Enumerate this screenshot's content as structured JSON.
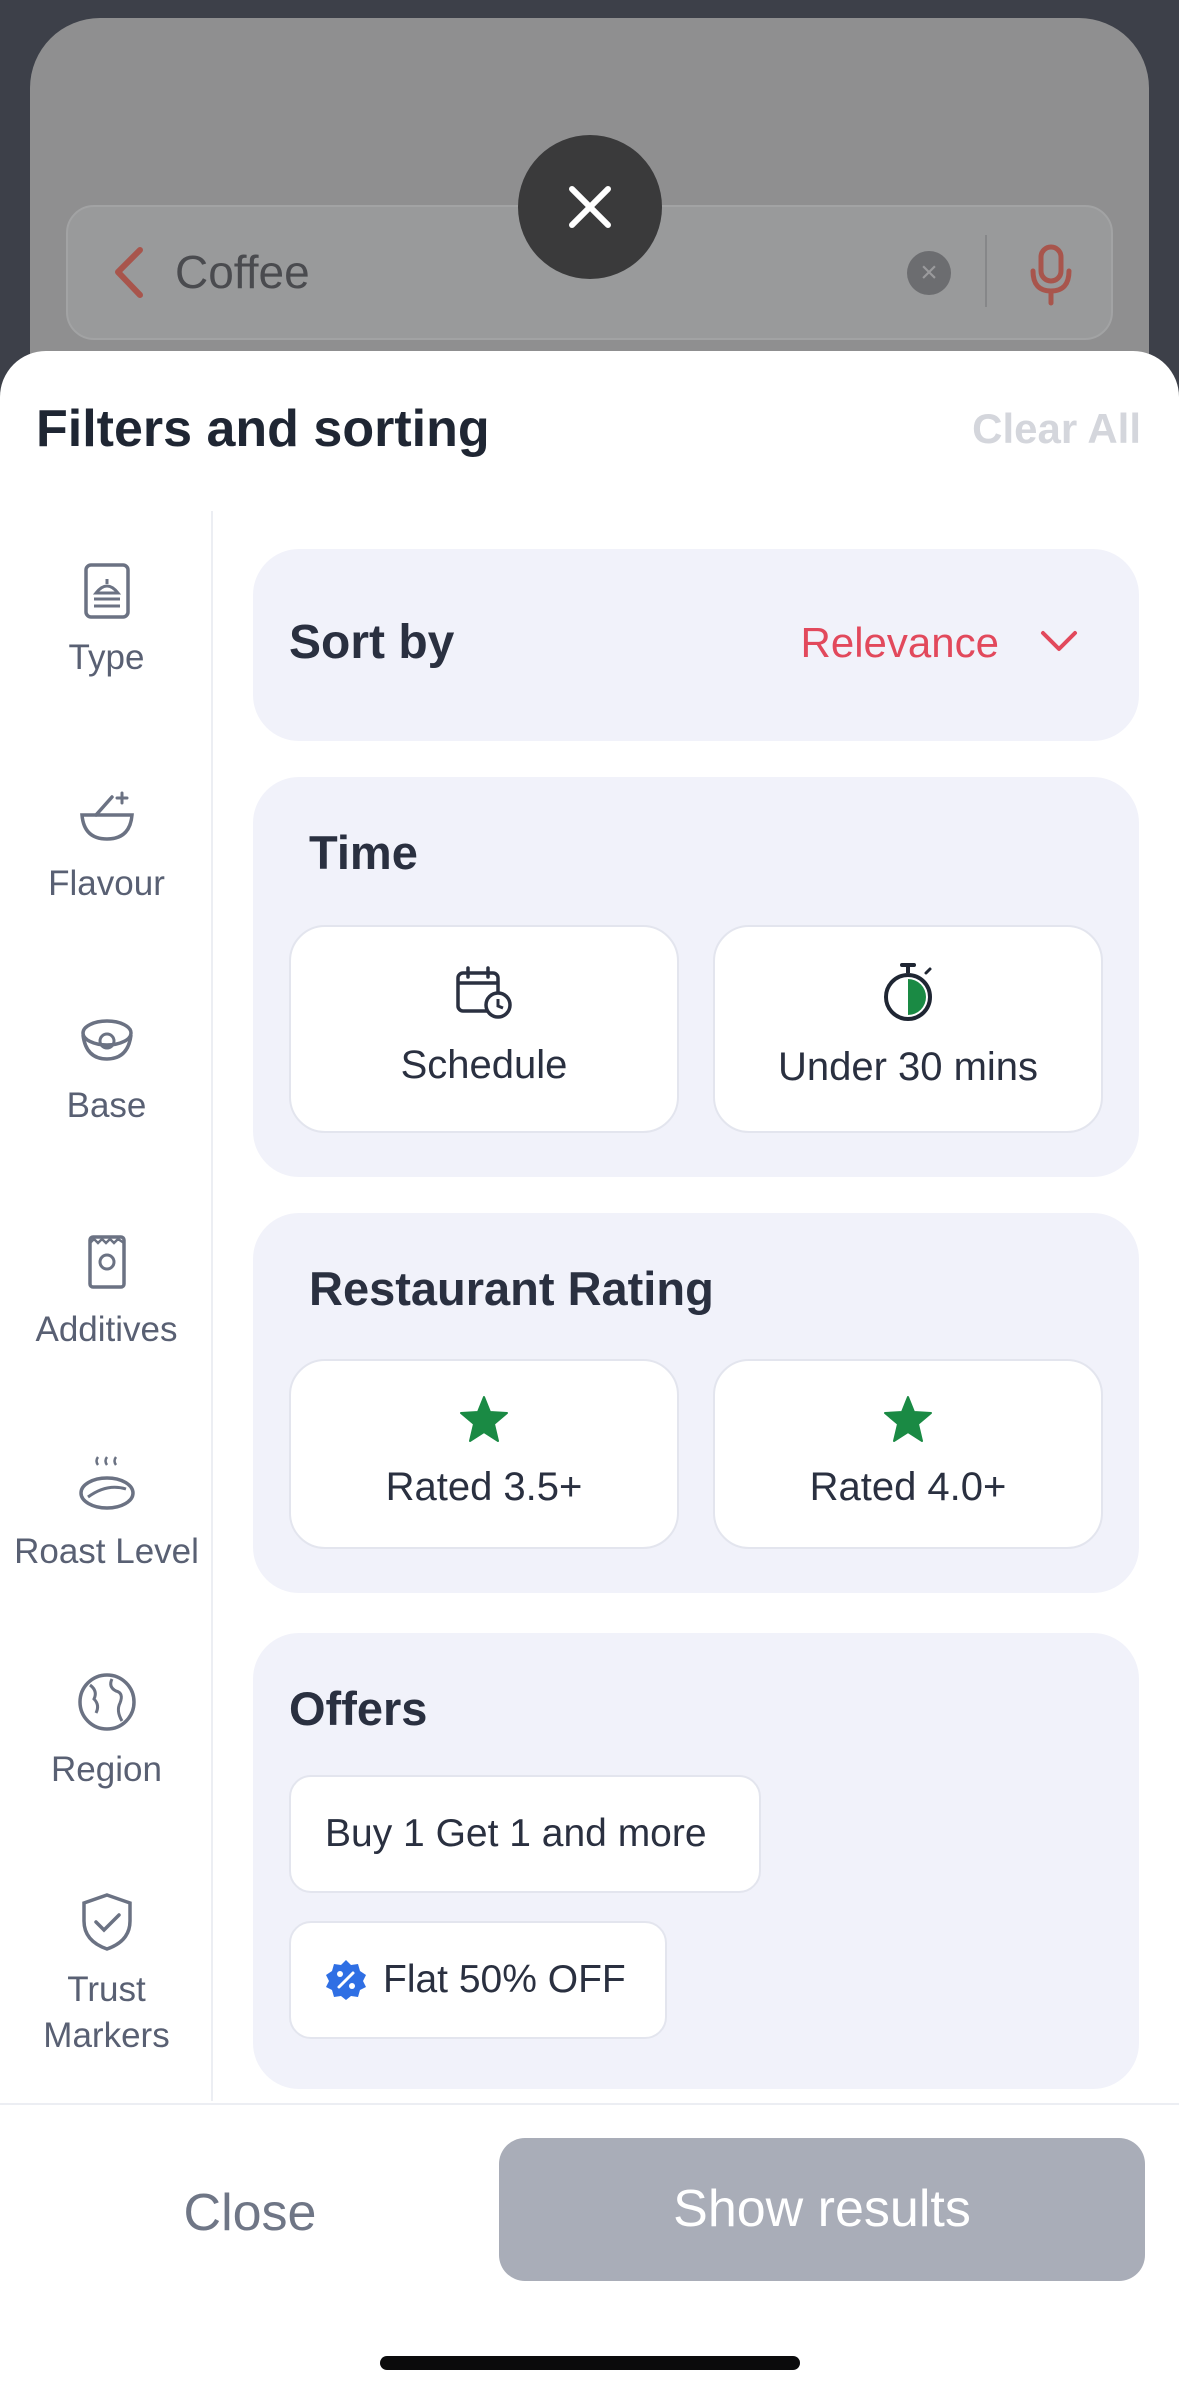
{
  "search": {
    "query": "Coffee",
    "icons": {
      "back": "chevron-left-icon",
      "clear": "clear-icon",
      "mic": "microphone-icon"
    }
  },
  "dismiss": {
    "icon": "close-icon"
  },
  "header": {
    "title": "Filters and sorting",
    "clear_all": "Clear All"
  },
  "sidebar": {
    "items": [
      {
        "label": "Type",
        "icon": "menu-card-icon"
      },
      {
        "label": "Flavour",
        "icon": "bowl-icon"
      },
      {
        "label": "Base",
        "icon": "bowl-base-icon"
      },
      {
        "label": "Additives",
        "icon": "packet-icon"
      },
      {
        "label": "Roast Level",
        "icon": "coffee-bean-steam-icon"
      },
      {
        "label": "Region",
        "icon": "globe-icon"
      },
      {
        "label": "Trust Markers",
        "icon": "shield-check-icon"
      }
    ]
  },
  "sort": {
    "label": "Sort by",
    "value": "Relevance"
  },
  "time": {
    "title": "Time",
    "options": [
      {
        "label": "Schedule",
        "icon": "calendar-clock-icon"
      },
      {
        "label": "Under 30 mins",
        "icon": "stopwatch-icon"
      }
    ]
  },
  "rating": {
    "title": "Restaurant Rating",
    "options": [
      {
        "label": "Rated 3.5+",
        "icon": "star-icon"
      },
      {
        "label": "Rated 4.0+",
        "icon": "star-icon"
      }
    ]
  },
  "offers": {
    "title": "Offers",
    "options": [
      {
        "label": "Buy 1 Get 1 and more"
      },
      {
        "label": "Flat 50% OFF",
        "icon": "discount-badge-icon"
      }
    ]
  },
  "footer": {
    "close": "Close",
    "show_results": "Show results"
  },
  "colors": {
    "accent": "#e2495c",
    "star": "#1a8a44",
    "badge": "#2f6fe4",
    "disabled_button": "#a9adb8"
  }
}
